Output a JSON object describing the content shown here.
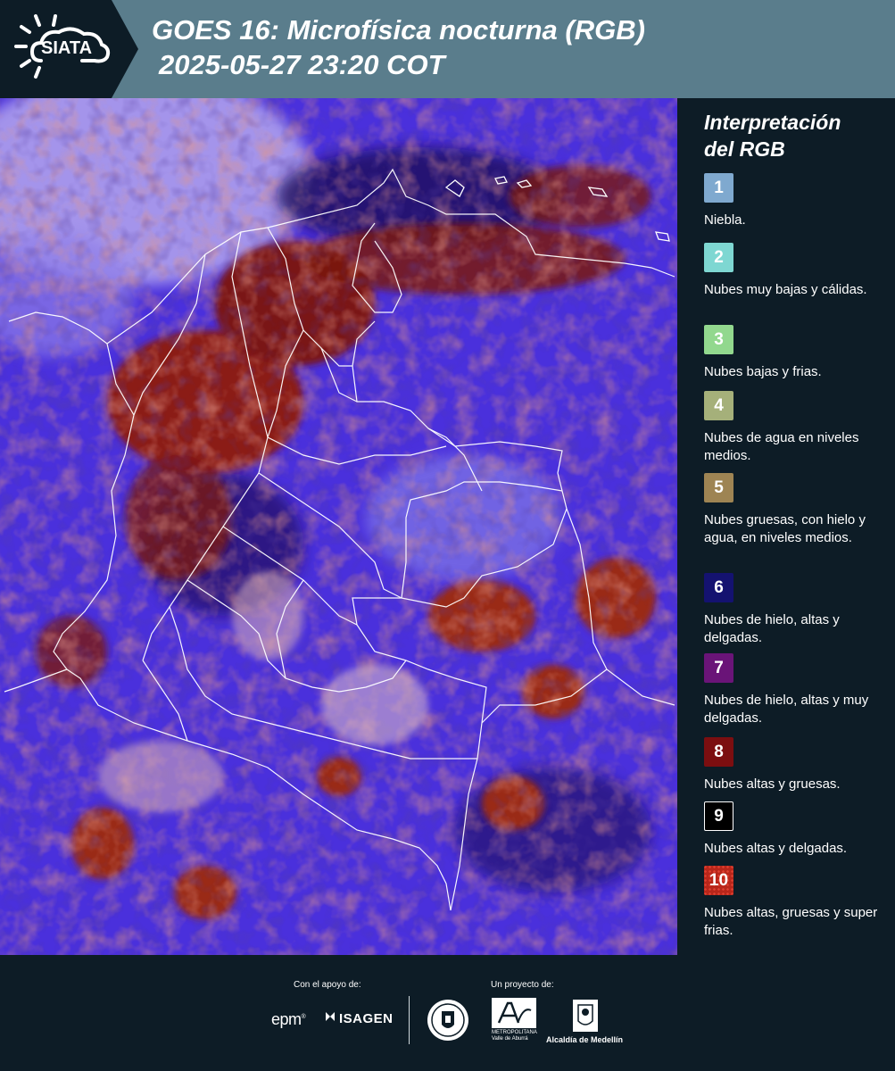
{
  "header": {
    "logo_text": "SIATA",
    "title_line1": "GOES 16: Microfísica nocturna (RGB)",
    "title_line2": "2025-05-27 23:20 COT"
  },
  "map": {
    "colors": {
      "background": "#4a2fd8",
      "high_thick_clouds": "#8b1a12",
      "ice_clouds": "#1a0a5a",
      "fog_light": "#b8a8f0",
      "warm_low": "#d9b8a0",
      "border_lines": "#ffffff"
    }
  },
  "legend": {
    "title_line1": "Interpretación",
    "title_line2": "del RGB",
    "items": [
      {
        "number": "1",
        "label": "Niebla.",
        "color": "#7fa9cf"
      },
      {
        "number": "2",
        "label": "Nubes muy bajas y cálidas.",
        "color": "#7ed7d2"
      },
      {
        "number": "3",
        "label": "Nubes bajas y frias.",
        "color": "#92d88e"
      },
      {
        "number": "4",
        "label": "Nubes de agua en niveles medios.",
        "color": "#a5b07a"
      },
      {
        "number": "5",
        "label": "Nubes gruesas, con hielo y agua, en niveles medios.",
        "color": "#9e8453"
      },
      {
        "number": "6",
        "label": "Nubes de hielo, altas y delgadas.",
        "color": "#141270"
      },
      {
        "number": "7",
        "label": "Nubes de hielo, altas y muy delgadas.",
        "color": "#6a1478"
      },
      {
        "number": "8",
        "label": "Nubes altas y gruesas.",
        "color": "#7c0e10"
      },
      {
        "number": "9",
        "label": "Nubes altas y delgadas.",
        "color": "#000000"
      },
      {
        "number": "10",
        "label": "Nubes altas, gruesas y super frias.",
        "color": "#b8261a"
      }
    ]
  },
  "footer": {
    "support_label": "Con el apoyo de:",
    "project_label": "Un proyecto de:",
    "sponsor1": "epm",
    "sponsor2": "ISAGEN",
    "metro_text": "METROPOLITANA Valle de Aburrá",
    "alcaldia_text": "Alcaldía de Medellín"
  }
}
